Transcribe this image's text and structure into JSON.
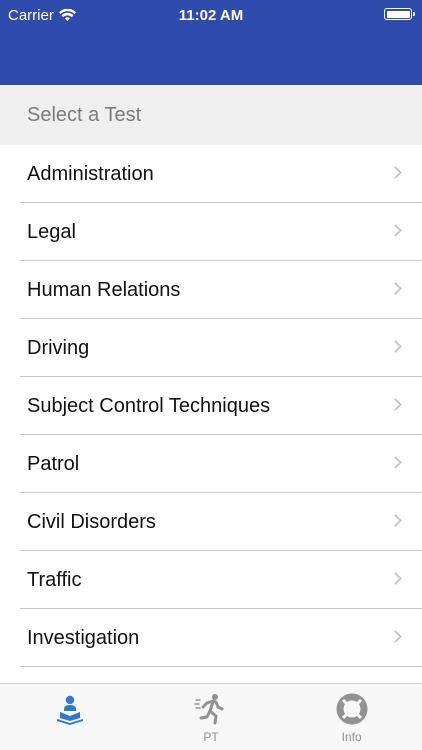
{
  "status_bar": {
    "carrier": "Carrier",
    "time": "11:02 AM"
  },
  "section": {
    "title": "Select a Test"
  },
  "tests": [
    {
      "label": "Administration"
    },
    {
      "label": "Legal"
    },
    {
      "label": "Human Relations"
    },
    {
      "label": "Driving"
    },
    {
      "label": "Subject Control Techniques"
    },
    {
      "label": "Patrol"
    },
    {
      "label": "Civil Disorders"
    },
    {
      "label": "Traffic"
    },
    {
      "label": "Investigation"
    }
  ],
  "tab_bar": {
    "tabs": [
      {
        "label": "",
        "icon": "study-icon",
        "selected": true
      },
      {
        "label": "PT",
        "icon": "running-icon",
        "selected": false
      },
      {
        "label": "Info",
        "icon": "lifebuoy-icon",
        "selected": false
      }
    ]
  },
  "colors": {
    "header": "#2f4bab",
    "active_tab": "#2f78d0",
    "inactive_tab": "#929292"
  }
}
